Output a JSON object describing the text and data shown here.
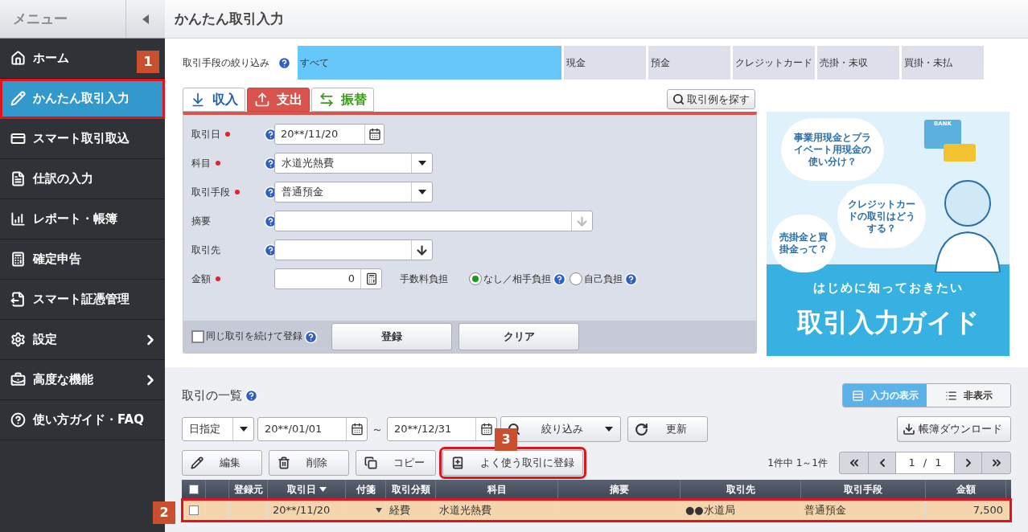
{
  "sidebar": {
    "title": "メニュー",
    "items": [
      {
        "label": "ホーム",
        "selected": false,
        "outlined": false,
        "has_submenu": false
      },
      {
        "label": "かんたん取引入力",
        "selected": true,
        "outlined": true,
        "has_submenu": false
      },
      {
        "label": "スマート取引取込",
        "selected": false,
        "outlined": false,
        "has_submenu": false
      },
      {
        "label": "仕訳の入力",
        "selected": false,
        "outlined": false,
        "has_submenu": false
      },
      {
        "label": "レポート・帳簿",
        "selected": false,
        "outlined": false,
        "has_submenu": false
      },
      {
        "label": "確定申告",
        "selected": false,
        "outlined": false,
        "has_submenu": false
      },
      {
        "label": "スマート証憑管理",
        "selected": false,
        "outlined": false,
        "has_submenu": false
      },
      {
        "label": "設定",
        "selected": false,
        "outlined": false,
        "has_submenu": true
      },
      {
        "label": "高度な機能",
        "selected": false,
        "outlined": false,
        "has_submenu": true
      },
      {
        "label": "使い方ガイド・FAQ",
        "selected": false,
        "outlined": false,
        "has_submenu": false
      }
    ]
  },
  "page_title": "かんたん取引入力",
  "filter": {
    "label": "取引手段の絞り込み",
    "options": [
      {
        "label": "すべて",
        "selected": true
      },
      {
        "label": "現金",
        "selected": false
      },
      {
        "label": "預金",
        "selected": false
      },
      {
        "label": "クレジットカード",
        "selected": false
      },
      {
        "label": "売掛・未収",
        "selected": false
      },
      {
        "label": "買掛・未払",
        "selected": false
      }
    ]
  },
  "entry_tabs": [
    {
      "label": "収入",
      "kind": "income",
      "selected": false
    },
    {
      "label": "支出",
      "kind": "expense",
      "selected": true
    },
    {
      "label": "振替",
      "kind": "transfer",
      "selected": false
    }
  ],
  "search_examples_button": "取引例を探す",
  "form_fields": [
    {
      "label": "取引日",
      "required": true,
      "kind": "date",
      "value": "20**/11/20"
    },
    {
      "label": "科目",
      "required": true,
      "kind": "select",
      "value": "水道光熱費"
    },
    {
      "label": "取引手段",
      "required": true,
      "kind": "select",
      "value": "普通預金"
    },
    {
      "label": "摘要",
      "required": false,
      "kind": "suggest_wide"
    },
    {
      "label": "取引先",
      "required": false,
      "kind": "suggest"
    },
    {
      "label": "金額",
      "required": true,
      "kind": "amount",
      "value": "0"
    }
  ],
  "fee": {
    "label": "手数料負担",
    "options": [
      {
        "label": "なし／相手負担",
        "selected": true
      },
      {
        "label": "自己負担",
        "selected": false
      }
    ]
  },
  "continue_checkbox": {
    "label": "同じ取引を続けて登録",
    "checked": false
  },
  "form_buttons": [
    "登録",
    "クリア"
  ],
  "banner": {
    "bubbles": [
      "事業用現金とプライベート用現金の使い分け？",
      "クレジットカードの取引はどうする？",
      "売掛金と買掛金って？"
    ],
    "card_label": "BANK",
    "subtitle": "はじめに知っておきたい",
    "title": "取引入力ガイド"
  },
  "list": {
    "title": "取引の一覧",
    "view_toggle": [
      {
        "label": "入力の表示",
        "selected": true
      },
      {
        "label": "非表示",
        "selected": false
      }
    ],
    "period_select": "日指定",
    "date_from": "20**/01/01",
    "range_separator": "～",
    "date_to": "20**/12/31",
    "filter_button": "絞り込み",
    "refresh_button": "更新",
    "download_button": "帳簿ダウンロード",
    "actions": [
      {
        "label": "編集",
        "outlined": false
      },
      {
        "label": "削除",
        "outlined": false
      },
      {
        "label": "コピー",
        "outlined": false
      },
      {
        "label": "よく使う取引に登録",
        "outlined": true
      }
    ],
    "count": "1件中 1～1件",
    "select_all_checked": false,
    "pager": {
      "page": "1",
      "separator": "/",
      "total": "1"
    },
    "columns": [
      "登録元",
      "取引日",
      "付箋",
      "取引分類",
      "科目",
      "摘要",
      "取引先",
      "取引手段",
      "金額"
    ],
    "rows": [
      {
        "checked": false,
        "highlighted": true,
        "outlined": true,
        "date": "20**/11/20",
        "category": "経費",
        "account": "水道光熱費",
        "partner": "●●水道局",
        "method": "普通預金",
        "amount": "7,500"
      }
    ]
  },
  "callouts": [
    "1",
    "2",
    "3"
  ]
}
